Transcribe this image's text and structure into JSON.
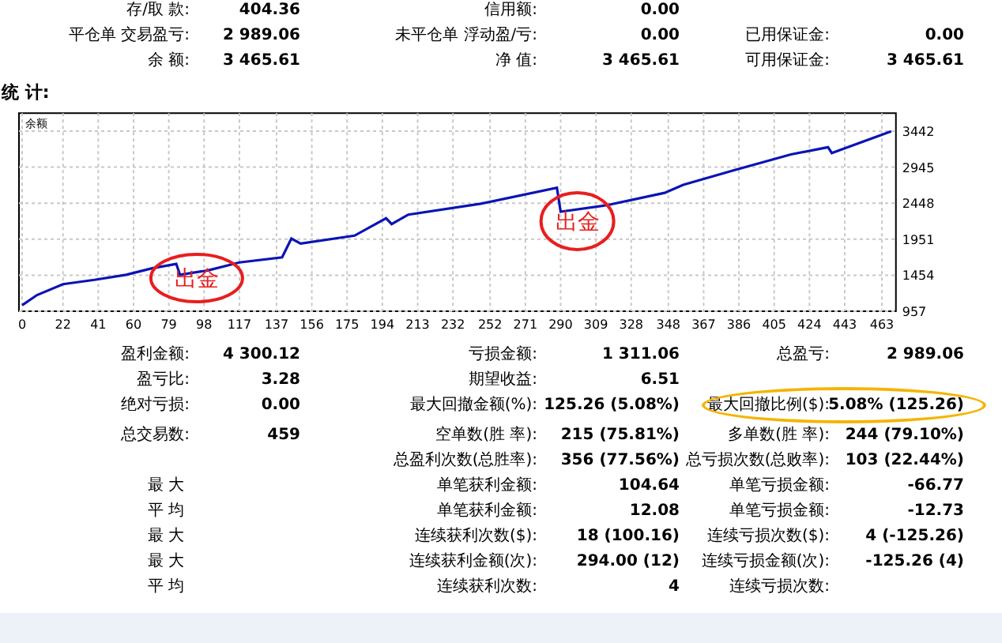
{
  "account": [
    [
      {
        "label": "存/取 款:",
        "value": "404.36"
      },
      {
        "label": "信用额:",
        "value": "0.00"
      }
    ],
    [
      {
        "label": "平仓单 交易盈亏:",
        "value": "2 989.06"
      },
      {
        "label": "未平仓单 浮动盈/亏:",
        "value": "0.00"
      },
      {
        "label": "已用保证金:",
        "value": "0.00"
      }
    ],
    [
      {
        "label": "余 额:",
        "value": "3 465.61"
      },
      {
        "label": "净 值:",
        "value": "3 465.61"
      },
      {
        "label": "可用保证金:",
        "value": "3 465.61"
      }
    ]
  ],
  "section_title": "统 计:",
  "chart_data": {
    "type": "line",
    "x": [
      0,
      8,
      22,
      39,
      56,
      70,
      83,
      85,
      100,
      117,
      140,
      145,
      150,
      179,
      196,
      199,
      208,
      247,
      288,
      290,
      315,
      346,
      356,
      383,
      414,
      434,
      436,
      468
    ],
    "series": [
      {
        "name": "余额",
        "color": "#0a14b4",
        "values": [
          1040,
          1180,
          1330,
          1390,
          1460,
          1550,
          1610,
          1460,
          1520,
          1630,
          1700,
          1960,
          1890,
          2000,
          2240,
          2160,
          2290,
          2440,
          2660,
          2330,
          2420,
          2590,
          2700,
          2900,
          3120,
          3220,
          3140,
          3440
        ]
      }
    ],
    "grid": true,
    "xlim": [
      0,
      468
    ],
    "ylim": [
      957,
      3690
    ],
    "xticks": [
      0,
      22,
      41,
      60,
      79,
      98,
      117,
      137,
      156,
      175,
      194,
      213,
      232,
      252,
      271,
      290,
      309,
      328,
      348,
      367,
      386,
      405,
      424,
      443,
      463
    ],
    "yticks": [
      957,
      1454,
      1951,
      2448,
      2945,
      3442
    ],
    "annotations": [
      "出金",
      "出金"
    ]
  },
  "stats": [
    [
      {
        "label": "盈利金额:",
        "value": "4 300.12"
      },
      {
        "label": "亏损金额:",
        "value": "1 311.06"
      },
      {
        "label": "总盈亏:",
        "value": "2 989.06"
      }
    ],
    [
      {
        "label": "盈亏比:",
        "value": "3.28"
      },
      {
        "label": "期望收益:",
        "value": "6.51"
      }
    ],
    [
      {
        "label": "绝对亏损:",
        "value": "0.00"
      },
      {
        "label": "最大回撤金额(%):",
        "value": "125.26 (5.08%)"
      },
      {
        "label": "最大回撤比例($):",
        "value": "5.08% (125.26)",
        "highlighted": true
      }
    ],
    [
      {
        "label": "总交易数:",
        "value": "459"
      },
      {
        "label": "空单数(胜 率):",
        "value": "215 (75.81%)"
      },
      {
        "label": "多单数(胜 率):",
        "value": "244 (79.10%)"
      }
    ],
    [
      {
        "kind": "empty"
      },
      {
        "label": "总盈利次数(总胜率):",
        "value": "356 (77.56%)"
      },
      {
        "label": "总亏损次数(总败率):",
        "value": "103 (22.44%)"
      }
    ],
    [
      {
        "kind": "group",
        "label": "最 大"
      },
      {
        "label": "单笔获利金额:",
        "value": "104.64"
      },
      {
        "label": "单笔亏损金额:",
        "value": "-66.77"
      }
    ],
    [
      {
        "kind": "group",
        "label": "平 均"
      },
      {
        "label": "单笔获利金额:",
        "value": "12.08"
      },
      {
        "label": "单笔亏损金额:",
        "value": "-12.73"
      }
    ],
    [
      {
        "kind": "group",
        "label": "最 大"
      },
      {
        "label": "连续获利次数($):",
        "value": "18 (100.16)"
      },
      {
        "label": "连续亏损次数($):",
        "value": "4 (-125.26)"
      }
    ],
    [
      {
        "kind": "group",
        "label": "最 大"
      },
      {
        "label": "连续获利金额(次):",
        "value": "294.00 (12)"
      },
      {
        "label": "连续亏损金额(次):",
        "value": "-125.26 (4)"
      }
    ],
    [
      {
        "kind": "group",
        "label": "平 均"
      },
      {
        "label": "连续获利次数:",
        "value": "4"
      },
      {
        "label": "连续亏损次数:"
      }
    ]
  ]
}
